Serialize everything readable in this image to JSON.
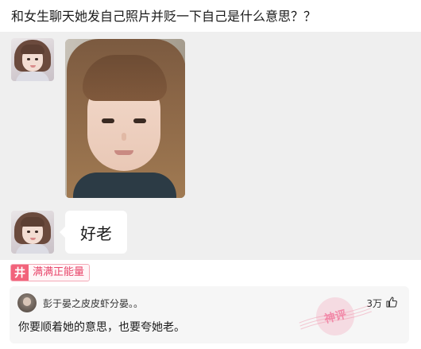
{
  "question": {
    "title": "和女生聊天她发自己照片并贬一下自己是什么意思？？"
  },
  "chat": {
    "reply_message": "好老"
  },
  "tag": {
    "icon_glyph": "井",
    "label": "满满正能量",
    "accent_color": "#f2637b"
  },
  "comment": {
    "username": "彭于晏之皮皮虾分晏。。",
    "likes": "3万",
    "text": "你要顺着她的意思，也要夸她老。",
    "stamp": "神评",
    "background_color": "#f6f6f6"
  },
  "colors": {
    "chat_background": "#efefef",
    "bubble": "#ffffff",
    "tag_text": "#e8466b"
  }
}
